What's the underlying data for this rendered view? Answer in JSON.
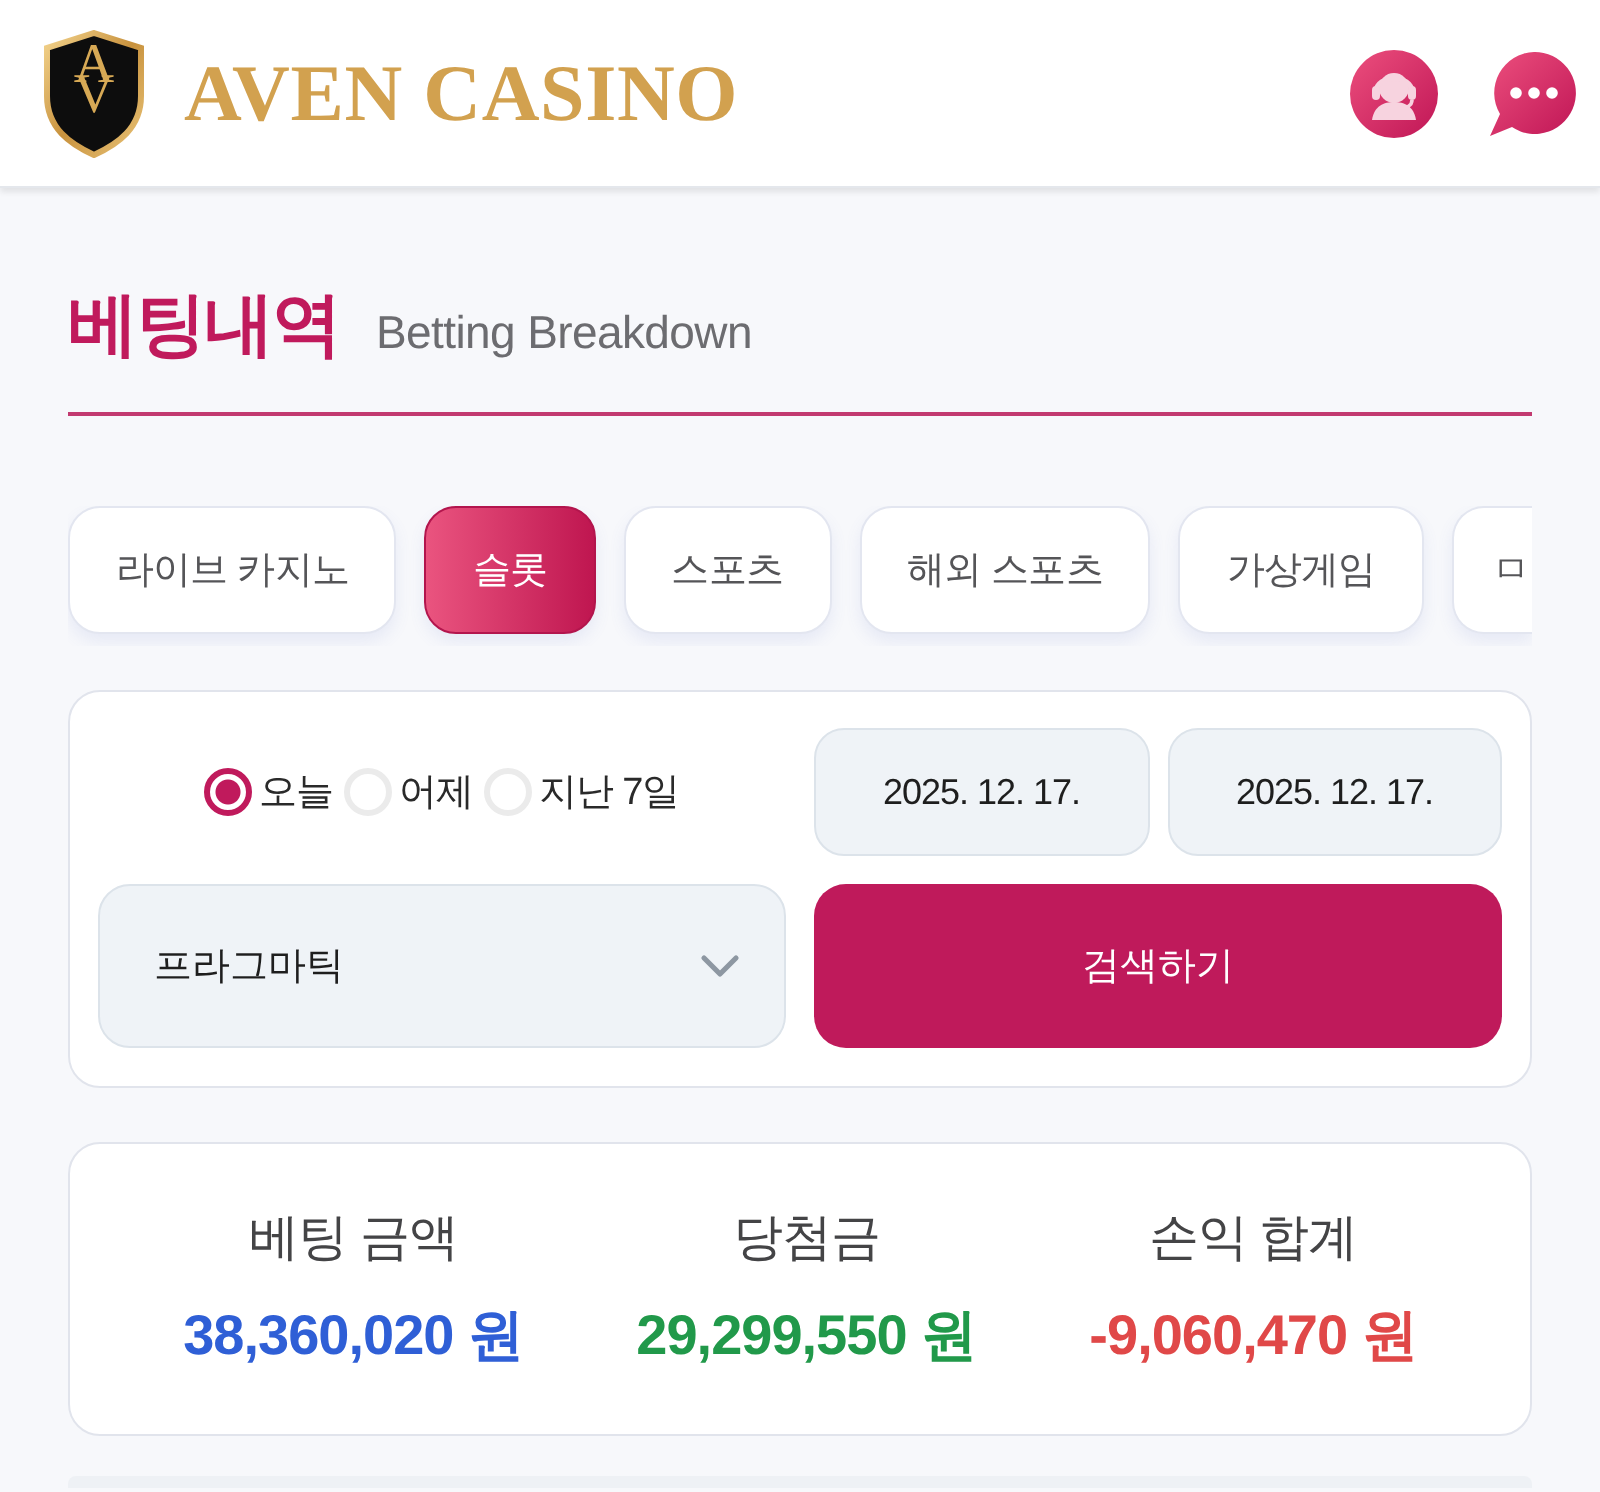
{
  "header": {
    "logo": {
      "monogram": "AV"
    },
    "brand": "AVEN CASINO"
  },
  "page_title": {
    "title": "베팅내역",
    "subtitle": "Betting Breakdown"
  },
  "tabs": [
    {
      "label": "라이브 카지노",
      "selected": false
    },
    {
      "label": "슬롯",
      "selected": true
    },
    {
      "label": "스포츠",
      "selected": false
    },
    {
      "label": "해외 스포츠",
      "selected": false
    },
    {
      "label": "가상게임",
      "selected": false
    },
    {
      "label": "ㅁ",
      "selected": false
    }
  ],
  "filter": {
    "periods": [
      {
        "label": "오늘",
        "selected": true
      },
      {
        "label": "어제",
        "selected": false
      },
      {
        "label": "지난 7일",
        "selected": false
      }
    ],
    "date_from": "2025. 12. 17.",
    "date_to": "2025. 12. 17.",
    "provider": "프라그마틱",
    "search_button": "검색하기"
  },
  "summary": [
    {
      "label": "베팅 금액",
      "value": "38,360,020 원",
      "color": "#2f5fd6"
    },
    {
      "label": "당첨금",
      "value": "29,299,550 원",
      "color": "#21994a"
    },
    {
      "label": "손익 합계",
      "value": "-9,060,470 원",
      "color": "#e04848"
    }
  ]
}
